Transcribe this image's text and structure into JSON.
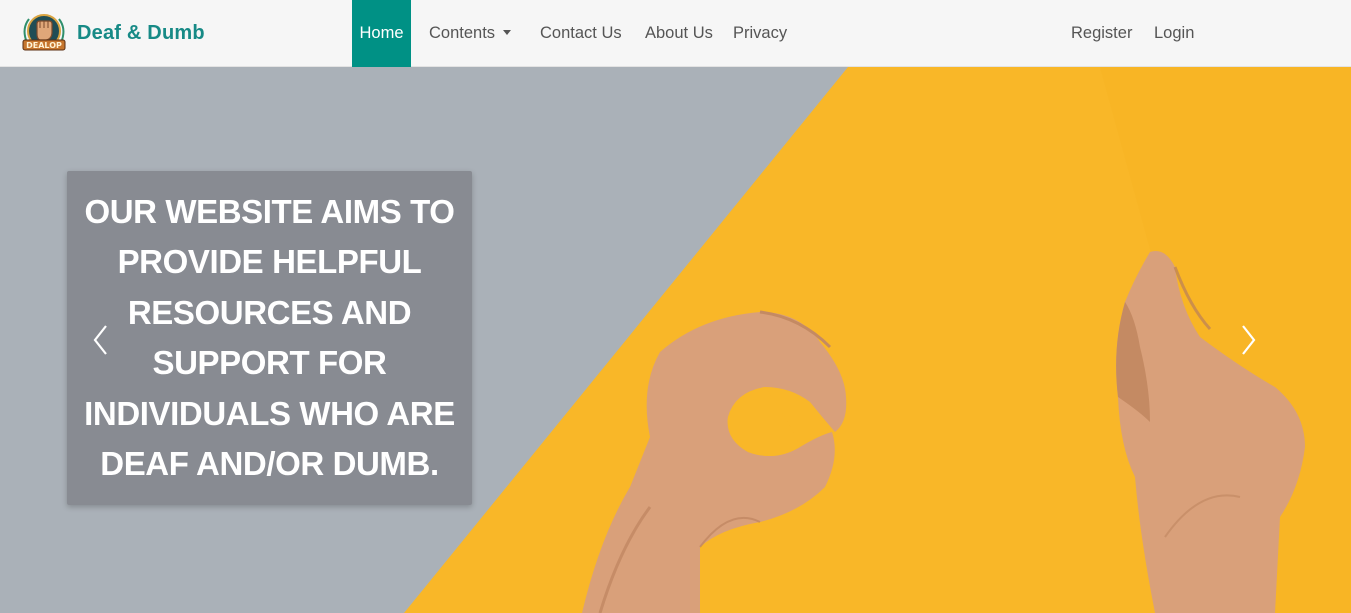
{
  "brand": {
    "name": "Deaf & Dumb",
    "logo_text": "DEALOP",
    "logo_icon": "fist-emblem-icon"
  },
  "nav": {
    "home": "Home",
    "contents": "Contents",
    "contact": "Contact Us",
    "about": "About Us",
    "privacy": "Privacy",
    "register": "Register",
    "login": "Login"
  },
  "hero": {
    "caption": "OUR WEBSITE AIMS TO PROVIDE HELPFUL RESOURCES AND SUPPORT FOR INDIVIDUALS WHO ARE DEAF AND/OR DUMB.",
    "prev_icon": "chevron-left-icon",
    "next_icon": "chevron-right-icon"
  },
  "colors": {
    "accent": "#009185",
    "brand_text": "#178a86",
    "hero_grey": "#aab1b8",
    "hero_yellow": "#f9b728",
    "caption_bg": "#80838a"
  }
}
